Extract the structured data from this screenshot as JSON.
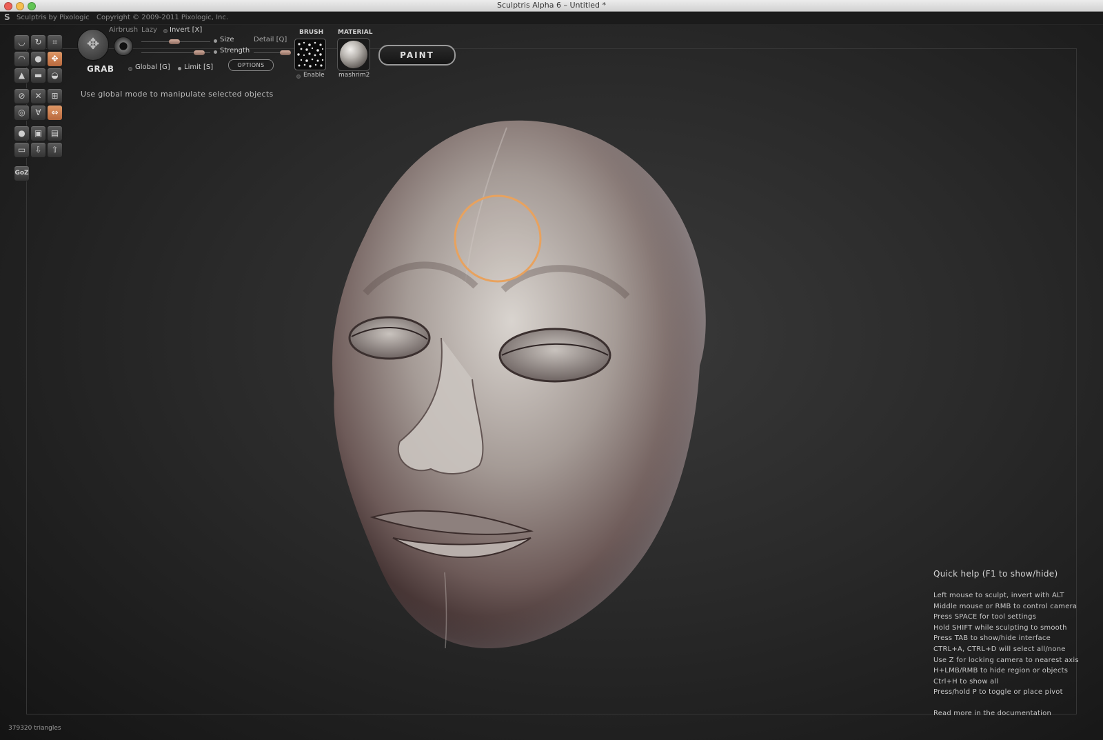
{
  "window": {
    "title": "Sculptris Alpha 6 – Untitled *"
  },
  "app_header": {
    "app_name": "Sculptris by Pixologic",
    "copyright": "Copyright © 2009-2011 Pixologic, Inc."
  },
  "toolbar": {
    "tools": [
      {
        "icon": "crease-icon",
        "active": false
      },
      {
        "icon": "rotate-icon",
        "active": false
      },
      {
        "icon": "scale-icon",
        "active": false
      },
      {
        "icon": "draw-icon",
        "active": false
      },
      {
        "icon": "inflate-icon",
        "active": false
      },
      {
        "icon": "grab-tool-icon",
        "active": true
      },
      {
        "icon": "pinch-icon",
        "active": false
      },
      {
        "icon": "flatten-icon",
        "active": false
      },
      {
        "icon": "smooth-icon",
        "active": false
      },
      {
        "icon": "reduce-brush-icon",
        "active": false
      },
      {
        "icon": "reduce-selection-icon",
        "active": false
      },
      {
        "icon": "subdivide-icon",
        "active": false
      },
      {
        "icon": "mask-icon",
        "active": false
      },
      {
        "icon": "wireframe-icon",
        "active": false
      },
      {
        "icon": "symmetry-icon",
        "active": true
      },
      {
        "icon": "sphere-icon",
        "active": false
      },
      {
        "icon": "save-icon",
        "active": false
      },
      {
        "icon": "load-icon",
        "active": false
      },
      {
        "icon": "plane-icon",
        "active": false
      },
      {
        "icon": "import-icon",
        "active": false
      },
      {
        "icon": "export-icon",
        "active": false
      }
    ],
    "goz_label": "GoZ"
  },
  "brush_settings": {
    "tool_name": "GRAB",
    "airbrush_label": "Airbrush",
    "lazy_label": "Lazy",
    "invert_label": "Invert [X]",
    "size_label": "Size",
    "strength_label": "Strength",
    "detail_label": "Detail [Q]",
    "global_label": "Global [G]",
    "limit_label": "Limit [S]",
    "options_label": "OPTIONS",
    "size_value": 0.48,
    "strength_value": 0.9
  },
  "brush": {
    "heading": "BRUSH",
    "enable_label": "Enable"
  },
  "material": {
    "heading": "MATERIAL",
    "name": "mashrim2"
  },
  "paint_button": {
    "label": "PAINT"
  },
  "status_hint": "Use global mode to manipulate selected objects",
  "quick_help": {
    "title": "Quick help (F1 to show/hide)",
    "lines": [
      "Left mouse to sculpt, invert with ALT",
      "Middle mouse or RMB to control camera",
      "Press SPACE for tool settings",
      "Hold SHIFT while sculpting to smooth",
      "Press TAB to show/hide interface",
      "CTRL+A, CTRL+D will select all/none",
      "Use Z for locking camera to nearest axis",
      "H+LMB/RMB to hide region or objects",
      "Ctrl+H to show all",
      "Press/hold P to toggle or place pivot"
    ],
    "more": "Read more in the documentation"
  },
  "triangle_count": "379320 triangles",
  "colors": {
    "accent": "#e0955f",
    "cursor_ring": "#e8a25e",
    "background": "#2a2a2a"
  }
}
